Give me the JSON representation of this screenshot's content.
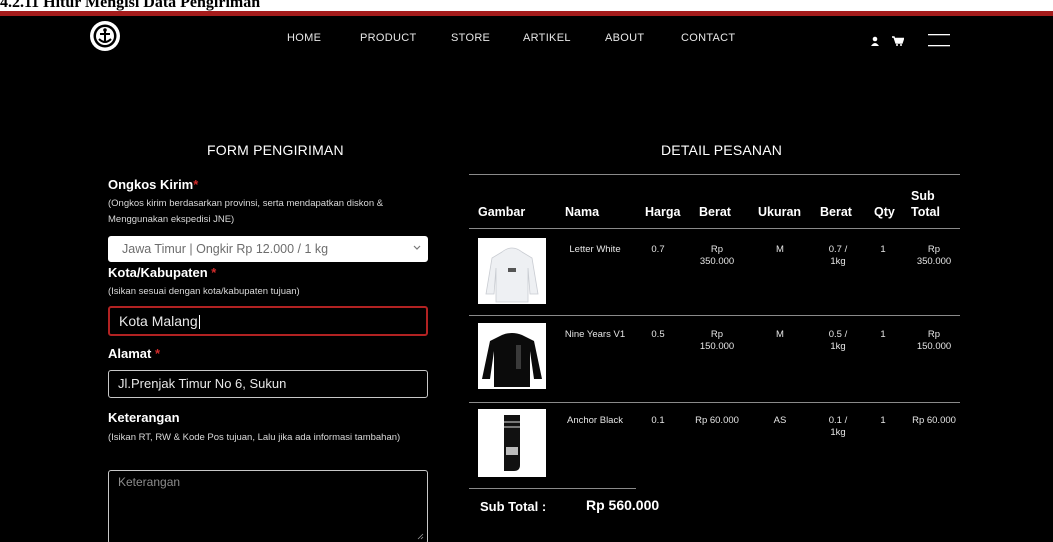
{
  "caption": "4.2.11 Hitur Mengisi Data Pengiriman",
  "nav": {
    "links": [
      "HOME",
      "PRODUCT",
      "STORE",
      "ARTIKEL",
      "ABOUT",
      "CONTACT"
    ]
  },
  "form": {
    "title": "FORM PENGIRIMAN",
    "ongkos": {
      "label": "Ongkos Kirim",
      "required": "*",
      "hint": "(Ongkos kirim berdasarkan provinsi, serta mendapatkan diskon & Menggunakan ekspedisi JNE)",
      "selected": "Jawa Timur | Ongkir Rp 12.000 / 1 kg"
    },
    "kota": {
      "label": "Kota/Kabupaten",
      "required": "*",
      "hint": "(Isikan sesuai dengan kota/kabupaten tujuan)",
      "value": "Kota Malang"
    },
    "alamat": {
      "label": "Alamat",
      "required": "*",
      "value": "Jl.Prenjak Timur No 6, Sukun"
    },
    "keterangan": {
      "label": "Keterangan",
      "hint": "(Isikan RT, RW & Kode Pos tujuan, Lalu jika ada informasi tambahan)",
      "placeholder": "Keterangan"
    }
  },
  "order": {
    "title": "DETAIL PESANAN",
    "headers": {
      "gambar": "Gambar",
      "nama": "Nama",
      "harga": "Harga",
      "berat": "Berat",
      "ukuran": "Ukuran",
      "berat2": "Berat",
      "qty": "Qty",
      "subtotal": "Sub Total"
    },
    "rows": [
      {
        "nama": "Letter White",
        "harga": "0.7",
        "berat": "Rp 350.000",
        "ukuran": "M",
        "berat2": "0.7 / 1kg",
        "qty": "1",
        "subtotal": "Rp 350.000"
      },
      {
        "nama": "Nine Years V1",
        "harga": "0.5",
        "berat": "Rp 150.000",
        "ukuran": "M",
        "berat2": "0.5 / 1kg",
        "qty": "1",
        "subtotal": "Rp 150.000"
      },
      {
        "nama": "Anchor Black",
        "harga": "0.1",
        "berat": "Rp 60.000",
        "ukuran": "AS",
        "berat2": "0.1 / 1kg",
        "qty": "1",
        "subtotal": "Rp 60.000"
      }
    ],
    "subtotal_label": "Sub Total :",
    "subtotal_value": "Rp 560.000"
  },
  "colors": {
    "background": "#000000",
    "accent_red": "#b22222",
    "caption_rule": "#a51c1c"
  },
  "icons": [
    "anchor-logo-icon",
    "user-icon",
    "cart-icon",
    "menu-icon",
    "chevron-down-icon",
    "resize-grip-icon"
  ]
}
